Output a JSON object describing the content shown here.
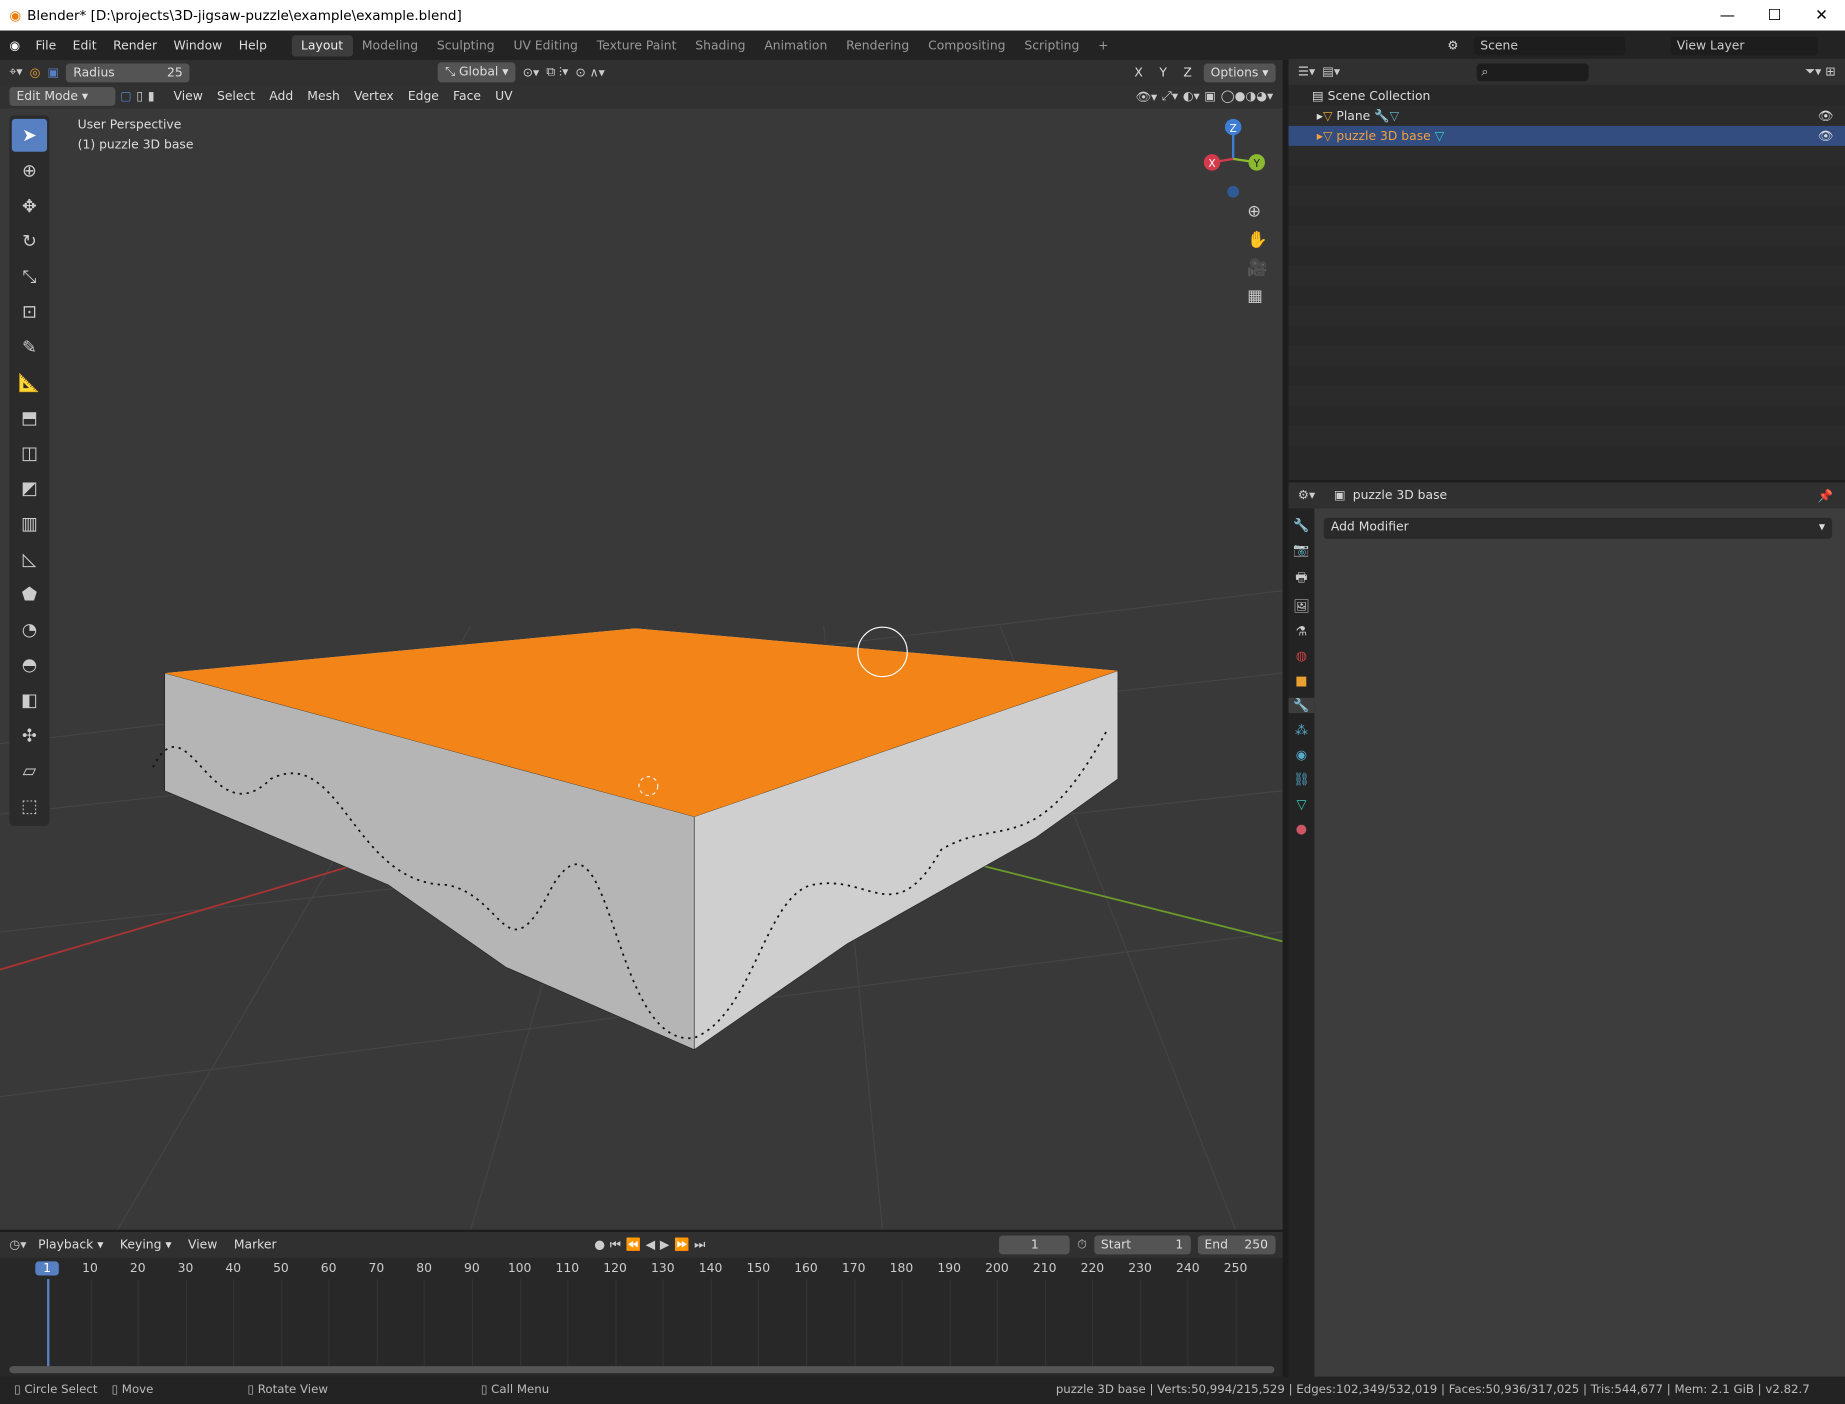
{
  "window": {
    "title": "Blender* [D:\\projects\\3D-jigsaw-puzzle\\example\\example.blend]",
    "minimize": "—",
    "maximize": "☐",
    "close": "✕"
  },
  "menu": [
    "File",
    "Edit",
    "Render",
    "Window",
    "Help"
  ],
  "workspaces": [
    "Layout",
    "Modeling",
    "Sculpting",
    "UV Editing",
    "Texture Paint",
    "Shading",
    "Animation",
    "Rendering",
    "Compositing",
    "Scripting",
    "+"
  ],
  "active_workspace": "Layout",
  "scene": {
    "label": "Scene",
    "view_layer": "View Layer"
  },
  "tool_header": {
    "radius_label": "Radius",
    "radius_value": "25",
    "orientation": "Global",
    "axes": [
      "X",
      "Y",
      "Z"
    ],
    "options": "Options"
  },
  "viewport_header": {
    "mode": "Edit Mode",
    "menus": [
      "View",
      "Select",
      "Add",
      "Mesh",
      "Vertex",
      "Edge",
      "Face",
      "UV"
    ]
  },
  "viewport": {
    "view_name": "User Perspective",
    "object_label": "(1) puzzle 3D base",
    "gizmo": {
      "x": "X",
      "y": "Y",
      "z": "Z"
    }
  },
  "outliner": {
    "collection": "Scene Collection",
    "items": [
      {
        "name": "Plane",
        "selected": false
      },
      {
        "name": "puzzle 3D base",
        "selected": true
      }
    ]
  },
  "properties": {
    "object_name": "puzzle 3D base",
    "add_modifier": "Add Modifier"
  },
  "timeline": {
    "menus": [
      "Playback",
      "Keying",
      "View",
      "Marker"
    ],
    "current_frame": "1",
    "start_label": "Start",
    "start": "1",
    "end_label": "End",
    "end": "250",
    "ticks": [
      "1",
      "10",
      "20",
      "30",
      "40",
      "50",
      "60",
      "70",
      "80",
      "90",
      "100",
      "110",
      "120",
      "130",
      "140",
      "150",
      "160",
      "170",
      "180",
      "190",
      "200",
      "210",
      "220",
      "230",
      "240",
      "250"
    ]
  },
  "statusbar": {
    "hints": [
      "Circle Select",
      "Move",
      "Rotate View",
      "Call Menu"
    ],
    "stats": "puzzle 3D base | Verts:50,994/215,529 | Edges:102,349/532,019 | Faces:50,936/317,025 | Tris:544,677 | Mem: 2.1 GiB | v2.82.7"
  },
  "colors": {
    "accent": "#5680c2",
    "selection": "#f5820f",
    "outliner_selected": "#334d80"
  }
}
